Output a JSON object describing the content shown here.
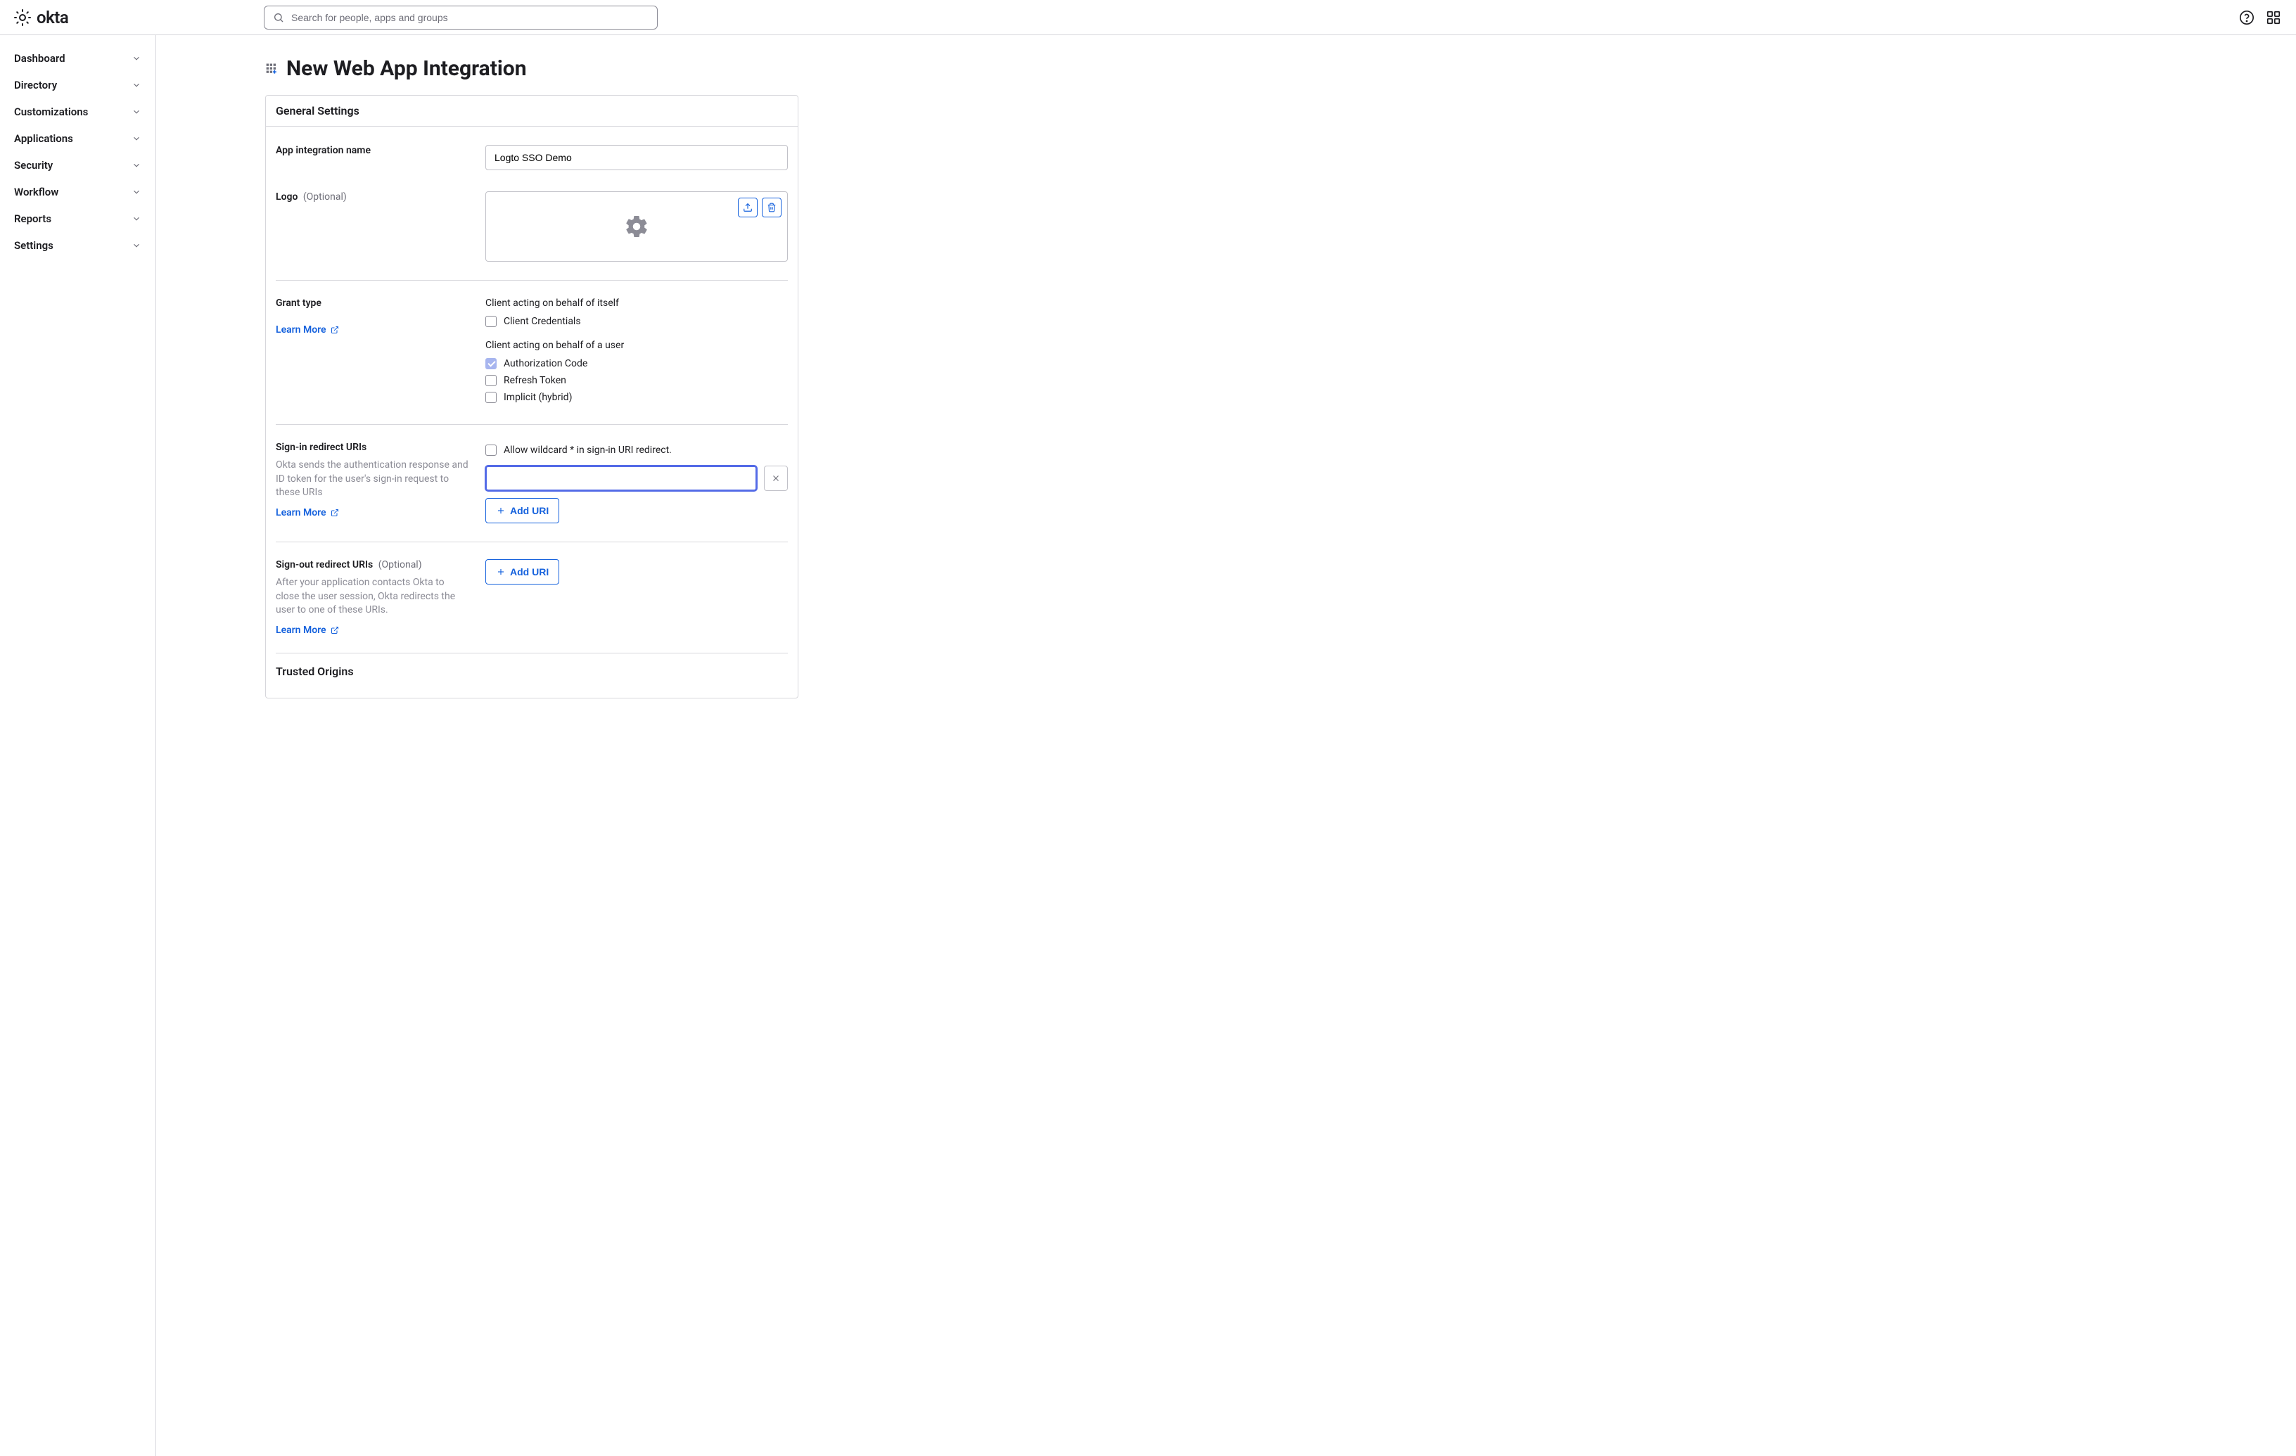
{
  "header": {
    "logo_text": "okta",
    "search_placeholder": "Search for people, apps and groups"
  },
  "sidebar": {
    "items": [
      {
        "label": "Dashboard"
      },
      {
        "label": "Directory"
      },
      {
        "label": "Customizations"
      },
      {
        "label": "Applications"
      },
      {
        "label": "Security"
      },
      {
        "label": "Workflow"
      },
      {
        "label": "Reports"
      },
      {
        "label": "Settings"
      }
    ]
  },
  "page": {
    "title": "New Web App Integration"
  },
  "form": {
    "general_settings_heading": "General Settings",
    "app_name_label": "App integration name",
    "app_name_value": "Logto SSO Demo",
    "logo_label": "Logo",
    "optional_text": "(Optional)",
    "grant_type": {
      "label": "Grant type",
      "learn_more": "Learn More",
      "group1_label": "Client acting on behalf of itself",
      "group1_items": [
        {
          "label": "Client Credentials",
          "checked": false
        }
      ],
      "group2_label": "Client acting on behalf of a user",
      "group2_items": [
        {
          "label": "Authorization Code",
          "checked": true
        },
        {
          "label": "Refresh Token",
          "checked": false
        },
        {
          "label": "Implicit (hybrid)",
          "checked": false
        }
      ]
    },
    "signin_redirect": {
      "label": "Sign-in redirect URIs",
      "help": "Okta sends the authentication response and ID token for the user's sign-in request to these URIs",
      "learn_more": "Learn More",
      "allow_wildcard_label": "Allow wildcard * in sign-in URI redirect.",
      "add_uri_label": "Add URI",
      "input_value": ""
    },
    "signout_redirect": {
      "label": "Sign-out redirect URIs",
      "optional": "(Optional)",
      "help": "After your application contacts Okta to close the user session, Okta redirects the user to one of these URIs.",
      "learn_more": "Learn More",
      "add_uri_label": "Add URI"
    },
    "trusted_origins_heading": "Trusted Origins"
  }
}
